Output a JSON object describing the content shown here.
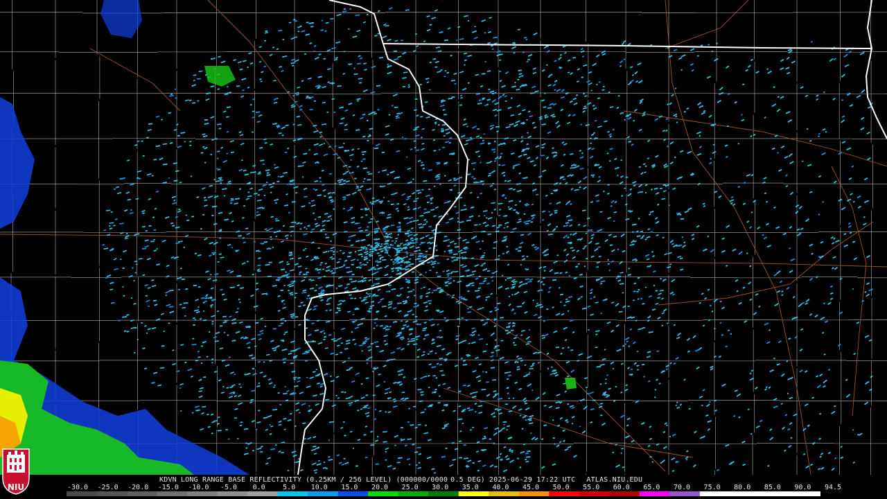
{
  "product": {
    "station": "KDVN",
    "product_name": "LONG RANGE BASE REFLECTIVITY",
    "resolution": "(0.25KM / 256 LEVEL)",
    "vcp": "(000000/0000",
    "elevation": "0.5 DEG)",
    "timestamp": "2025-06-29 17:22 UTC",
    "source": "ATLAS.NIU.EDU"
  },
  "logo": {
    "name": "NIU"
  },
  "color_scale": {
    "labels": [
      "-30.0",
      "-25.0",
      "-20.0",
      "-15.0",
      "-10.0",
      "-5.0",
      "0.0",
      "5.0",
      "10.0",
      "15.0",
      "20.0",
      "25.0",
      "30.0",
      "35.0",
      "40.0",
      "45.0",
      "50.0",
      "55.0",
      "60.0",
      "65.0",
      "70.0",
      "75.0",
      "80.0",
      "85.0",
      "90.0",
      "94.5"
    ],
    "colors": [
      "#4a4a4a",
      "#555555",
      "#606060",
      "#707070",
      "#808080",
      "#909090",
      "#a0a0a0",
      "#00c8f0",
      "#00a0f0",
      "#0050f0",
      "#00e000",
      "#00b000",
      "#008000",
      "#ffff00",
      "#e8c000",
      "#ff9000",
      "#ff0000",
      "#d00000",
      "#b00000",
      "#ff00ff",
      "#9955cc",
      "#ffffff",
      "#ffffff",
      "#ffffff",
      "#ffffff"
    ]
  },
  "palette": {
    "background": "#000000",
    "state_border": "#ffffff",
    "county_line": "#b4b4b4",
    "highway": "#a0522d",
    "echo_light": "#2ec4e8",
    "echo_mid": "#1a8fe0",
    "echo_blue": "#1040e0",
    "echo_green": "#18c818",
    "echo_yellow": "#f0f000",
    "echo_orange": "#f8a000"
  }
}
